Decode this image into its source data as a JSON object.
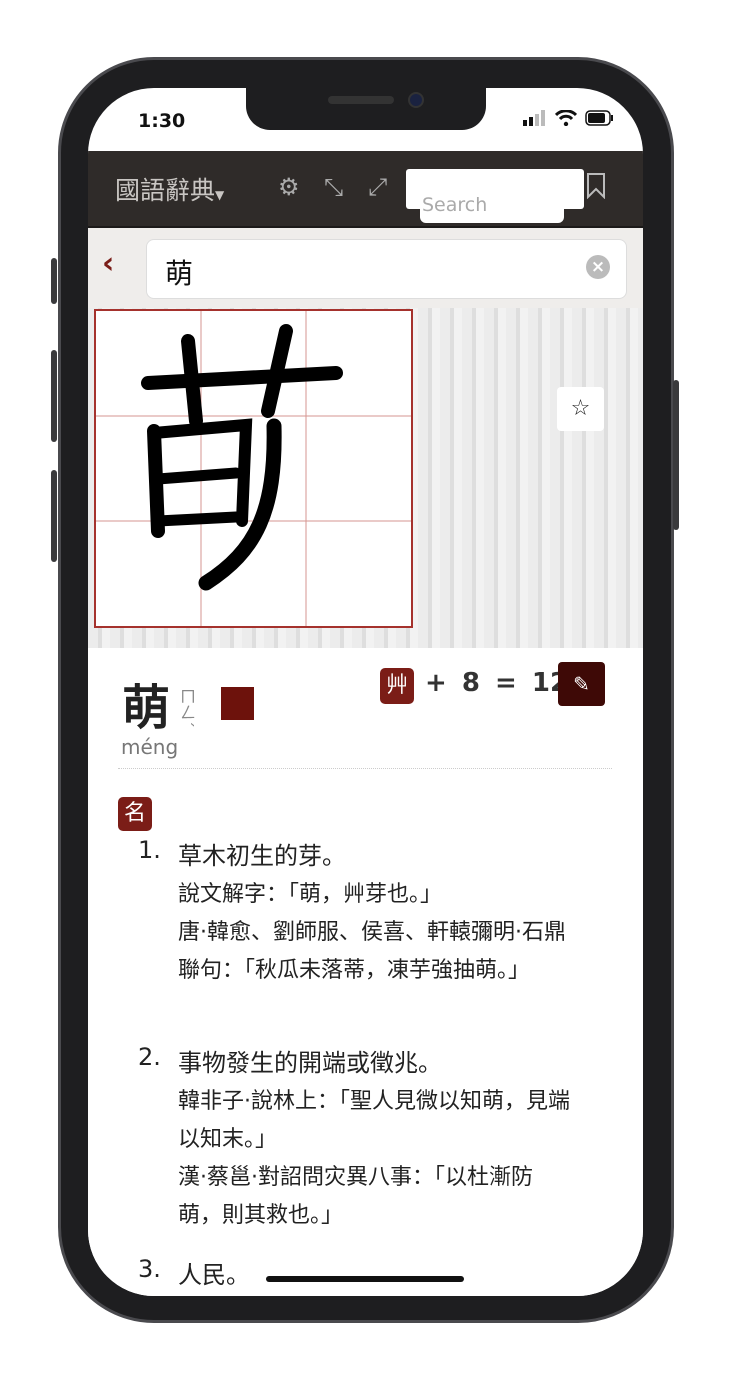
{
  "status": {
    "time": "1:30"
  },
  "header": {
    "title": "國語辭典",
    "search_placeholder": "Search",
    "icons": [
      "gears-icon",
      "compress-icon",
      "expand-icon",
      "bookmark-icon"
    ]
  },
  "query": {
    "value": "萌"
  },
  "entry": {
    "char": "萌",
    "bopomofo": "ㄇㄥˊ",
    "pinyin": "méng",
    "radical": "艸",
    "radical_plus": "+ 8",
    "equals": "=",
    "strokes": "12",
    "pos": "名",
    "definitions": [
      {
        "num": "1.",
        "text": "草木初生的芽。",
        "examples": [
          "說文解字：「萌，艸芽也。」",
          "唐·韓愈、劉師服、侯喜、軒轅彌明·石鼎聯句：「秋瓜未落蒂，凍芋強抽萌。」"
        ]
      },
      {
        "num": "2.",
        "text": "事物發生的開端或徵兆。",
        "examples": [
          "韓非子·說林上：「聖人見微以知萌，見端以知末。」",
          "漢·蔡邕·對詔問灾異八事：「以杜漸防萌，則其救也。」"
        ]
      },
      {
        "num": "3.",
        "text": "人民。",
        "examples": []
      }
    ]
  },
  "colors": {
    "accent": "#7b1d17",
    "header_bg": "#2f2b29",
    "swatch": "#6d120c"
  }
}
